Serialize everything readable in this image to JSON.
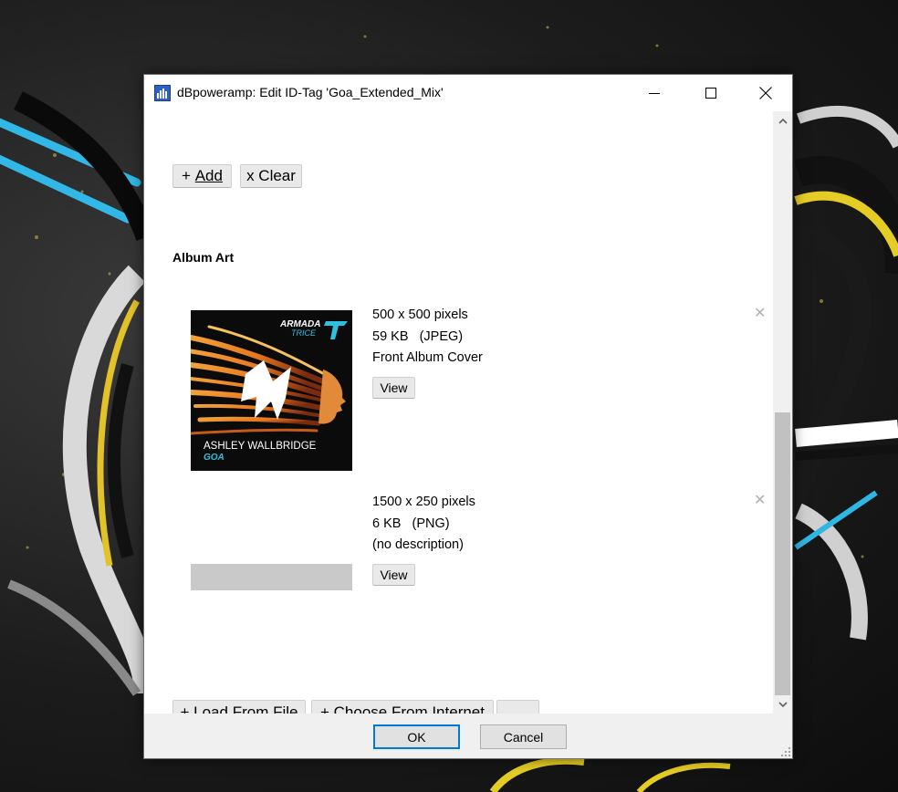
{
  "window": {
    "title": "dBpoweramp: Edit ID-Tag 'Goa_Extended_Mix'"
  },
  "tags_toolbar": {
    "add_prefix": "+ ",
    "add_label": "Add",
    "clear_label": "x Clear"
  },
  "album_art": {
    "section_title": "Album Art",
    "items": [
      {
        "dimensions": "500 x 500 pixels",
        "size": "59 KB   (JPEG)",
        "description": "Front Album Cover",
        "view_label": "View",
        "remove_glyph": "✕",
        "cover": {
          "label_line1": "ARMADA",
          "label_line2": "TRICE",
          "artist": "ASHLEY WALLBRIDGE",
          "track": "GOA"
        }
      },
      {
        "dimensions": "1500 x 250 pixels",
        "size": "6 KB   (PNG)",
        "description": "(no description)",
        "view_label": "View",
        "remove_glyph": "✕"
      }
    ],
    "load_from_file_label": "+ Load From File",
    "choose_from_internet_label": "+ Choose From Internet",
    "more_label": "..."
  },
  "footer": {
    "ok_label": "OK",
    "cancel_label": "Cancel"
  },
  "icons": {
    "app": "dbpoweramp-app-icon",
    "minimize": "minimize-icon",
    "maximize": "maximize-icon",
    "close": "close-icon",
    "scroll_up": "chevron-up-icon",
    "scroll_down": "chevron-down-icon"
  },
  "colors": {
    "accent": "#0078d7",
    "cover_accent": "#2ec0e0",
    "cover_orange": "#e8781e"
  }
}
